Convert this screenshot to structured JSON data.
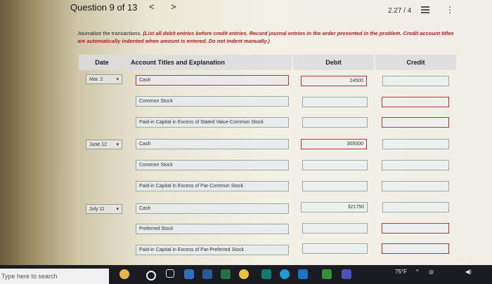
{
  "header": {
    "question_label": "Question 9 of 13",
    "prev": "<",
    "next": ">",
    "score": "2.27 / 4"
  },
  "instructions": {
    "lead": "Journalize the transactions.",
    "emphasis": "(List all debit entries before credit entries. Record journal entries in the order presented in the problem. Credit account titles are automatically indented when amount is entered. Do not indent manually.)"
  },
  "table": {
    "headers": {
      "date": "Date",
      "account": "Account Titles and Explanation",
      "debit": "Debit",
      "credit": "Credit"
    },
    "rows": [
      {
        "date": "Mar. 2",
        "account": "Cash",
        "debit": "24500",
        "credit": ""
      },
      {
        "date": "",
        "account": "Common Stock",
        "debit": "",
        "credit": ""
      },
      {
        "date": "",
        "account": "Paid-in Capital in Excess of Stated Value-Common Stock",
        "debit": "",
        "credit": ""
      },
      {
        "date": "June 12",
        "account": "Cash",
        "debit": "305000",
        "credit": ""
      },
      {
        "date": "",
        "account": "Common Stock",
        "debit": "",
        "credit": ""
      },
      {
        "date": "",
        "account": "Paid-in Capital in Excess of Par-Common Stock",
        "debit": "",
        "credit": ""
      },
      {
        "date": "July 11",
        "account": "Cash",
        "debit": "321750",
        "credit": ""
      },
      {
        "date": "",
        "account": "Preferred Stock",
        "debit": "",
        "credit": ""
      },
      {
        "date": "",
        "account": "Paid-in Capital in Excess of Par-Preferred Stock",
        "debit": "",
        "credit": ""
      }
    ]
  },
  "taskbar": {
    "search_placeholder": "Type here to search",
    "temperature": "75°F"
  },
  "colors": {
    "error_border": "#c03030",
    "taskbar_bg": "#1b1b22"
  }
}
